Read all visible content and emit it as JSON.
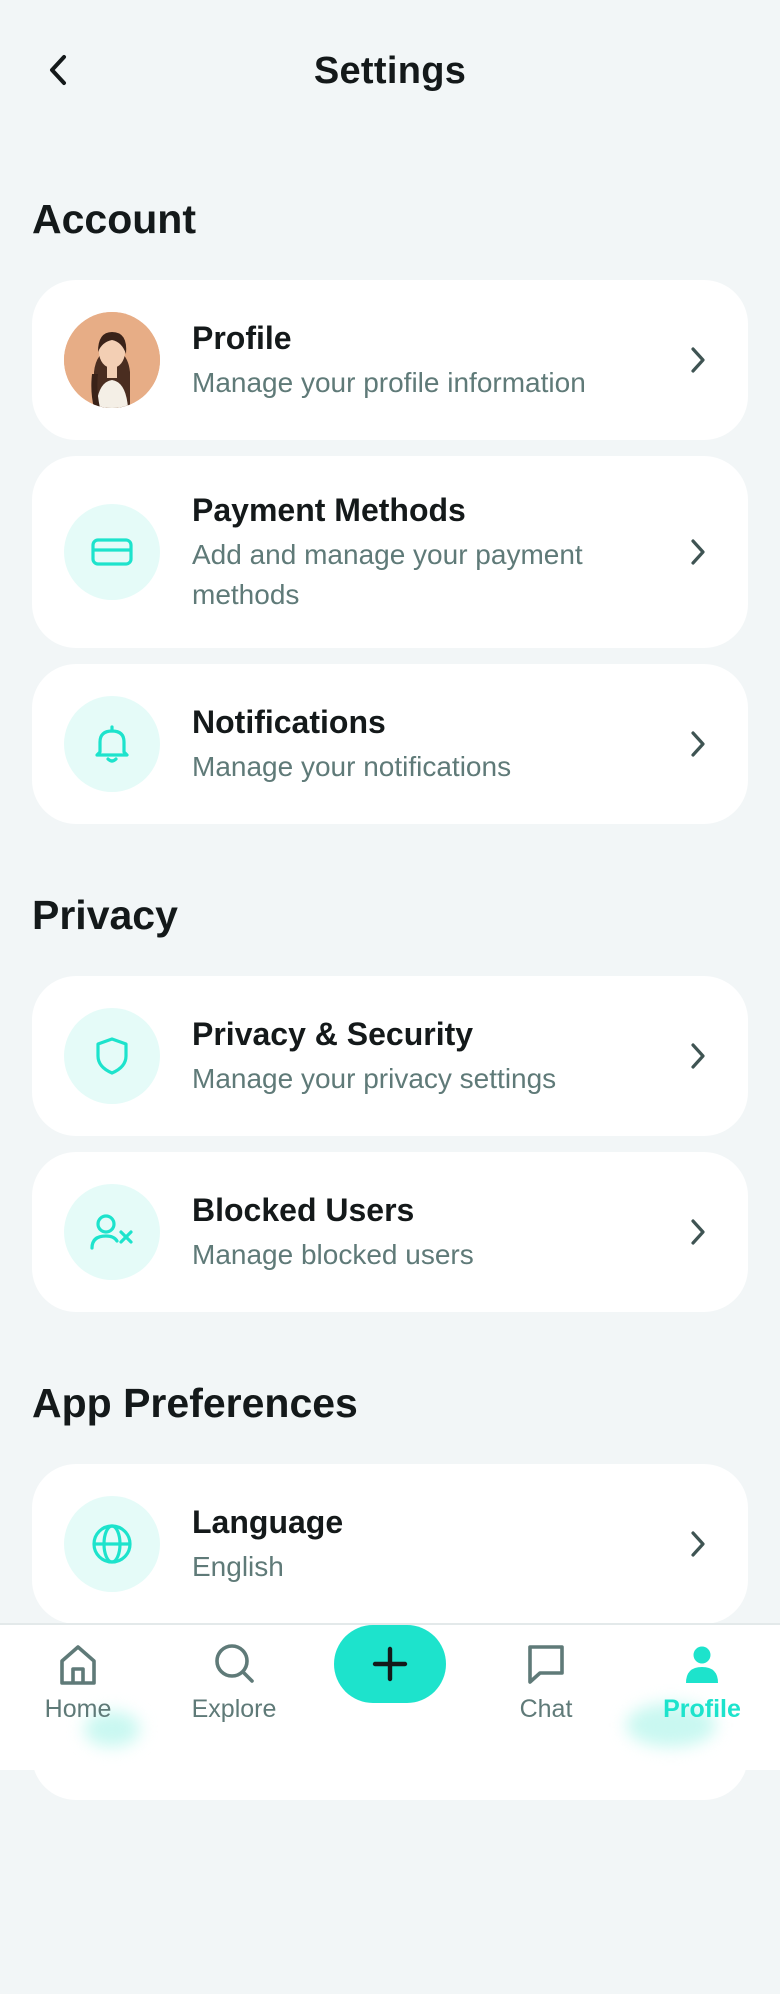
{
  "header": {
    "title": "Settings"
  },
  "sections": {
    "account": {
      "title": "Account",
      "items": [
        {
          "title": "Profile",
          "subtitle": "Manage your profile information"
        },
        {
          "title": "Payment Methods",
          "subtitle": "Add and manage your payment methods"
        },
        {
          "title": "Notifications",
          "subtitle": "Manage your notifications"
        }
      ]
    },
    "privacy": {
      "title": "Privacy",
      "items": [
        {
          "title": "Privacy & Security",
          "subtitle": "Manage your privacy settings"
        },
        {
          "title": "Blocked Users",
          "subtitle": "Manage blocked users"
        }
      ]
    },
    "preferences": {
      "title": "App Preferences",
      "items": [
        {
          "title": "Language",
          "subtitle": "English"
        }
      ]
    }
  },
  "bottom_nav": {
    "items": [
      {
        "label": "Home",
        "icon": "home-icon"
      },
      {
        "label": "Explore",
        "icon": "search-icon"
      },
      {
        "label": "Chat",
        "icon": "chat-icon"
      },
      {
        "label": "Profile",
        "icon": "user-icon",
        "active": true
      }
    ],
    "fab_icon": "plus-icon"
  },
  "colors": {
    "accent": "#1de3cc",
    "background": "#f2f6f7",
    "card": "#ffffff",
    "icon_bg": "#e5fbf8",
    "text_primary": "#14191a",
    "text_secondary": "#5f7a78"
  }
}
